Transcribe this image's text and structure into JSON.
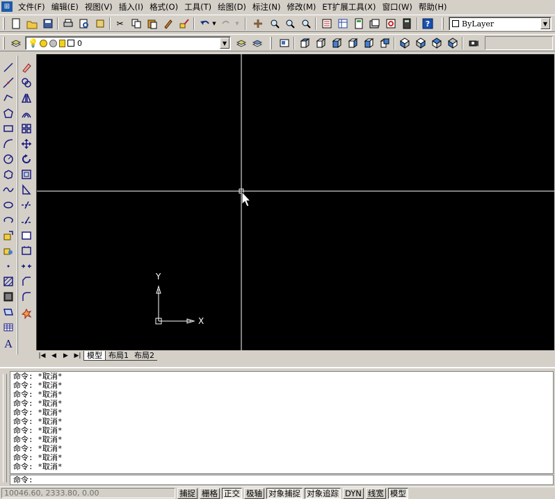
{
  "menubar": {
    "items": [
      {
        "label": "文件(F)"
      },
      {
        "label": "编辑(E)"
      },
      {
        "label": "视图(V)"
      },
      {
        "label": "插入(I)"
      },
      {
        "label": "格式(O)"
      },
      {
        "label": "工具(T)"
      },
      {
        "label": "绘图(D)"
      },
      {
        "label": "标注(N)"
      },
      {
        "label": "修改(M)"
      },
      {
        "label": "ET扩展工具(X)"
      },
      {
        "label": "窗口(W)"
      },
      {
        "label": "帮助(H)"
      }
    ]
  },
  "toolbar": {
    "linetype_combo": "ByLayer",
    "layer_combo": "0"
  },
  "canvas": {
    "ucs_x_label": "X",
    "ucs_y_label": "Y"
  },
  "layout_tabs": [
    {
      "label": "模型",
      "active": true
    },
    {
      "label": "布局1",
      "active": false
    },
    {
      "label": "布局2",
      "active": false
    }
  ],
  "command": {
    "history": [
      "命令: *取消*",
      "命令: *取消*",
      "命令: *取消*",
      "命令: *取消*",
      "命令: *取消*",
      "命令: *取消*",
      "命令: *取消*",
      "命令: *取消*",
      "命令: *取消*",
      "命令: *取消*",
      "命令: *取消*"
    ],
    "prompt": "命令:"
  },
  "status": {
    "coords": "10046.60, 2333.80, 0.00",
    "buttons": [
      {
        "label": "捕捉",
        "on": false
      },
      {
        "label": "栅格",
        "on": false
      },
      {
        "label": "正交",
        "on": true
      },
      {
        "label": "极轴",
        "on": false
      },
      {
        "label": "对象捕捉",
        "on": true
      },
      {
        "label": "对象追踪",
        "on": true
      },
      {
        "label": "DYN",
        "on": false
      },
      {
        "label": "线宽",
        "on": false
      },
      {
        "label": "模型",
        "on": true
      }
    ]
  },
  "colors": {
    "canvas_bg": "#000000",
    "chrome": "#d4d0c8",
    "crosshair": "#ffffff"
  }
}
